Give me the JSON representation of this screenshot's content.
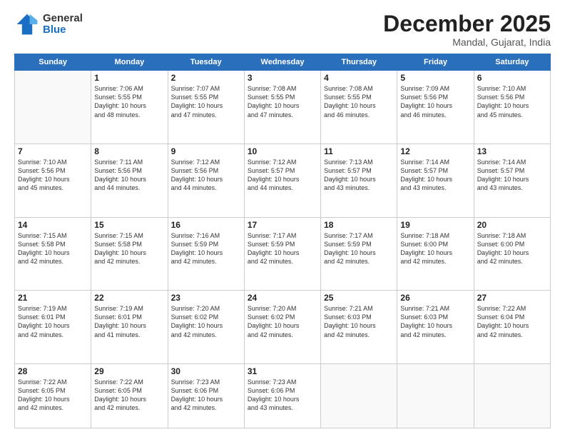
{
  "logo": {
    "general": "General",
    "blue": "Blue"
  },
  "header": {
    "month": "December 2025",
    "location": "Mandal, Gujarat, India"
  },
  "weekdays": [
    "Sunday",
    "Monday",
    "Tuesday",
    "Wednesday",
    "Thursday",
    "Friday",
    "Saturday"
  ],
  "weeks": [
    [
      {
        "day": "",
        "info": ""
      },
      {
        "day": "1",
        "info": "Sunrise: 7:06 AM\nSunset: 5:55 PM\nDaylight: 10 hours\nand 48 minutes."
      },
      {
        "day": "2",
        "info": "Sunrise: 7:07 AM\nSunset: 5:55 PM\nDaylight: 10 hours\nand 47 minutes."
      },
      {
        "day": "3",
        "info": "Sunrise: 7:08 AM\nSunset: 5:55 PM\nDaylight: 10 hours\nand 47 minutes."
      },
      {
        "day": "4",
        "info": "Sunrise: 7:08 AM\nSunset: 5:55 PM\nDaylight: 10 hours\nand 46 minutes."
      },
      {
        "day": "5",
        "info": "Sunrise: 7:09 AM\nSunset: 5:56 PM\nDaylight: 10 hours\nand 46 minutes."
      },
      {
        "day": "6",
        "info": "Sunrise: 7:10 AM\nSunset: 5:56 PM\nDaylight: 10 hours\nand 45 minutes."
      }
    ],
    [
      {
        "day": "7",
        "info": "Sunrise: 7:10 AM\nSunset: 5:56 PM\nDaylight: 10 hours\nand 45 minutes."
      },
      {
        "day": "8",
        "info": "Sunrise: 7:11 AM\nSunset: 5:56 PM\nDaylight: 10 hours\nand 44 minutes."
      },
      {
        "day": "9",
        "info": "Sunrise: 7:12 AM\nSunset: 5:56 PM\nDaylight: 10 hours\nand 44 minutes."
      },
      {
        "day": "10",
        "info": "Sunrise: 7:12 AM\nSunset: 5:57 PM\nDaylight: 10 hours\nand 44 minutes."
      },
      {
        "day": "11",
        "info": "Sunrise: 7:13 AM\nSunset: 5:57 PM\nDaylight: 10 hours\nand 43 minutes."
      },
      {
        "day": "12",
        "info": "Sunrise: 7:14 AM\nSunset: 5:57 PM\nDaylight: 10 hours\nand 43 minutes."
      },
      {
        "day": "13",
        "info": "Sunrise: 7:14 AM\nSunset: 5:57 PM\nDaylight: 10 hours\nand 43 minutes."
      }
    ],
    [
      {
        "day": "14",
        "info": "Sunrise: 7:15 AM\nSunset: 5:58 PM\nDaylight: 10 hours\nand 42 minutes."
      },
      {
        "day": "15",
        "info": "Sunrise: 7:15 AM\nSunset: 5:58 PM\nDaylight: 10 hours\nand 42 minutes."
      },
      {
        "day": "16",
        "info": "Sunrise: 7:16 AM\nSunset: 5:59 PM\nDaylight: 10 hours\nand 42 minutes."
      },
      {
        "day": "17",
        "info": "Sunrise: 7:17 AM\nSunset: 5:59 PM\nDaylight: 10 hours\nand 42 minutes."
      },
      {
        "day": "18",
        "info": "Sunrise: 7:17 AM\nSunset: 5:59 PM\nDaylight: 10 hours\nand 42 minutes."
      },
      {
        "day": "19",
        "info": "Sunrise: 7:18 AM\nSunset: 6:00 PM\nDaylight: 10 hours\nand 42 minutes."
      },
      {
        "day": "20",
        "info": "Sunrise: 7:18 AM\nSunset: 6:00 PM\nDaylight: 10 hours\nand 42 minutes."
      }
    ],
    [
      {
        "day": "21",
        "info": "Sunrise: 7:19 AM\nSunset: 6:01 PM\nDaylight: 10 hours\nand 42 minutes."
      },
      {
        "day": "22",
        "info": "Sunrise: 7:19 AM\nSunset: 6:01 PM\nDaylight: 10 hours\nand 41 minutes."
      },
      {
        "day": "23",
        "info": "Sunrise: 7:20 AM\nSunset: 6:02 PM\nDaylight: 10 hours\nand 42 minutes."
      },
      {
        "day": "24",
        "info": "Sunrise: 7:20 AM\nSunset: 6:02 PM\nDaylight: 10 hours\nand 42 minutes."
      },
      {
        "day": "25",
        "info": "Sunrise: 7:21 AM\nSunset: 6:03 PM\nDaylight: 10 hours\nand 42 minutes."
      },
      {
        "day": "26",
        "info": "Sunrise: 7:21 AM\nSunset: 6:03 PM\nDaylight: 10 hours\nand 42 minutes."
      },
      {
        "day": "27",
        "info": "Sunrise: 7:22 AM\nSunset: 6:04 PM\nDaylight: 10 hours\nand 42 minutes."
      }
    ],
    [
      {
        "day": "28",
        "info": "Sunrise: 7:22 AM\nSunset: 6:05 PM\nDaylight: 10 hours\nand 42 minutes."
      },
      {
        "day": "29",
        "info": "Sunrise: 7:22 AM\nSunset: 6:05 PM\nDaylight: 10 hours\nand 42 minutes."
      },
      {
        "day": "30",
        "info": "Sunrise: 7:23 AM\nSunset: 6:06 PM\nDaylight: 10 hours\nand 42 minutes."
      },
      {
        "day": "31",
        "info": "Sunrise: 7:23 AM\nSunset: 6:06 PM\nDaylight: 10 hours\nand 43 minutes."
      },
      {
        "day": "",
        "info": ""
      },
      {
        "day": "",
        "info": ""
      },
      {
        "day": "",
        "info": ""
      }
    ]
  ]
}
